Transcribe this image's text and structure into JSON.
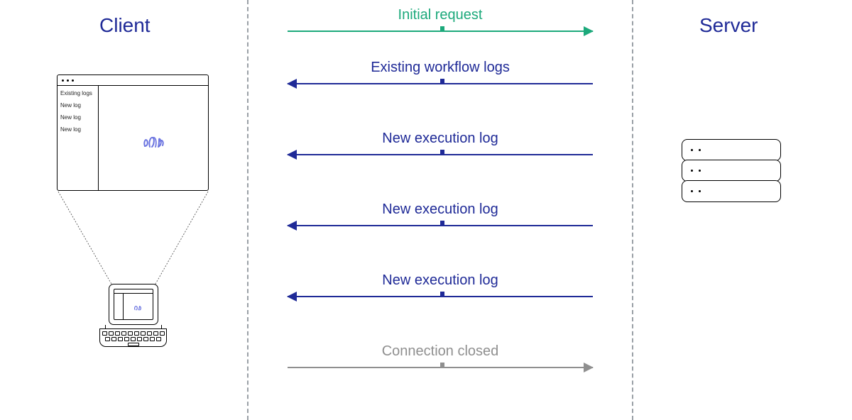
{
  "titles": {
    "client": "Client",
    "server": "Server"
  },
  "browser_logs": [
    "Existing logs",
    "New log",
    "New log",
    "New log"
  ],
  "arrows": [
    {
      "label": "Initial request",
      "direction": "right",
      "color": "green"
    },
    {
      "label": "Existing workflow logs",
      "direction": "left",
      "color": "blue"
    },
    {
      "label": "New execution log",
      "direction": "left",
      "color": "blue"
    },
    {
      "label": "New execution log",
      "direction": "left",
      "color": "blue"
    },
    {
      "label": "New execution log",
      "direction": "left",
      "color": "blue"
    },
    {
      "label": "Connection closed",
      "direction": "right",
      "color": "gray"
    }
  ],
  "colors": {
    "green": "#1CA97B",
    "blue": "#1F2A97",
    "gray": "#8F8F8F"
  }
}
